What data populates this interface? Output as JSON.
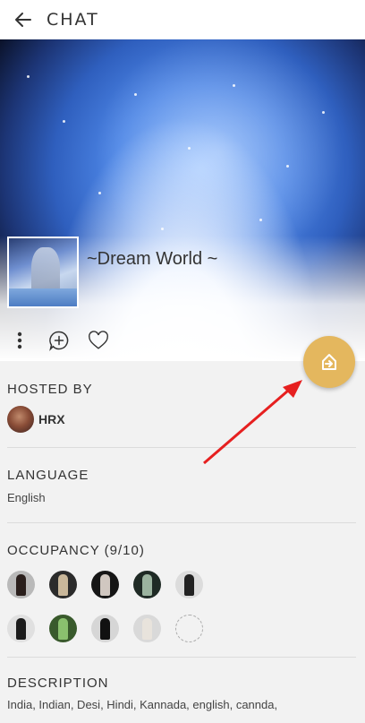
{
  "header": {
    "title": "CHAT",
    "back_icon": "arrow-left-icon"
  },
  "room": {
    "name": "~Dream World ~"
  },
  "actions": [
    {
      "name": "more-options-icon"
    },
    {
      "name": "add-chat-icon"
    },
    {
      "name": "heart-icon"
    }
  ],
  "fab": {
    "icon": "join-room-icon",
    "color": "#e4b75e"
  },
  "hosted_by": {
    "label": "HOSTED BY",
    "host_name": "HRX"
  },
  "language": {
    "label": "LANGUAGE",
    "value": "English"
  },
  "occupancy": {
    "label": "OCCUPANCY (9/10)",
    "avatars": [
      {
        "colors": [
          "#b9b9b9",
          "#2a1f1c"
        ]
      },
      {
        "colors": [
          "#2b2b2b",
          "#c9b79a"
        ]
      },
      {
        "colors": [
          "#161616",
          "#d0c7c0"
        ]
      },
      {
        "colors": [
          "#1f2a25",
          "#9bb39f"
        ]
      },
      {
        "colors": [
          "#dcdcdc",
          "#222222"
        ]
      },
      {
        "colors": [
          "#e0e0e0",
          "#1b1b1b"
        ]
      },
      {
        "colors": [
          "#395a2c",
          "#8ac06e"
        ]
      },
      {
        "colors": [
          "#d6d6d6",
          "#111111"
        ]
      },
      {
        "colors": [
          "#d9d9d9",
          "#e8e3dc"
        ]
      },
      {
        "colors": [],
        "empty": true
      }
    ]
  },
  "description": {
    "label": "DESCRIPTION",
    "text": "India, Indian, Desi, Hindi, Kannada, english, cannda,"
  },
  "annotation": {
    "color": "#e62020"
  }
}
